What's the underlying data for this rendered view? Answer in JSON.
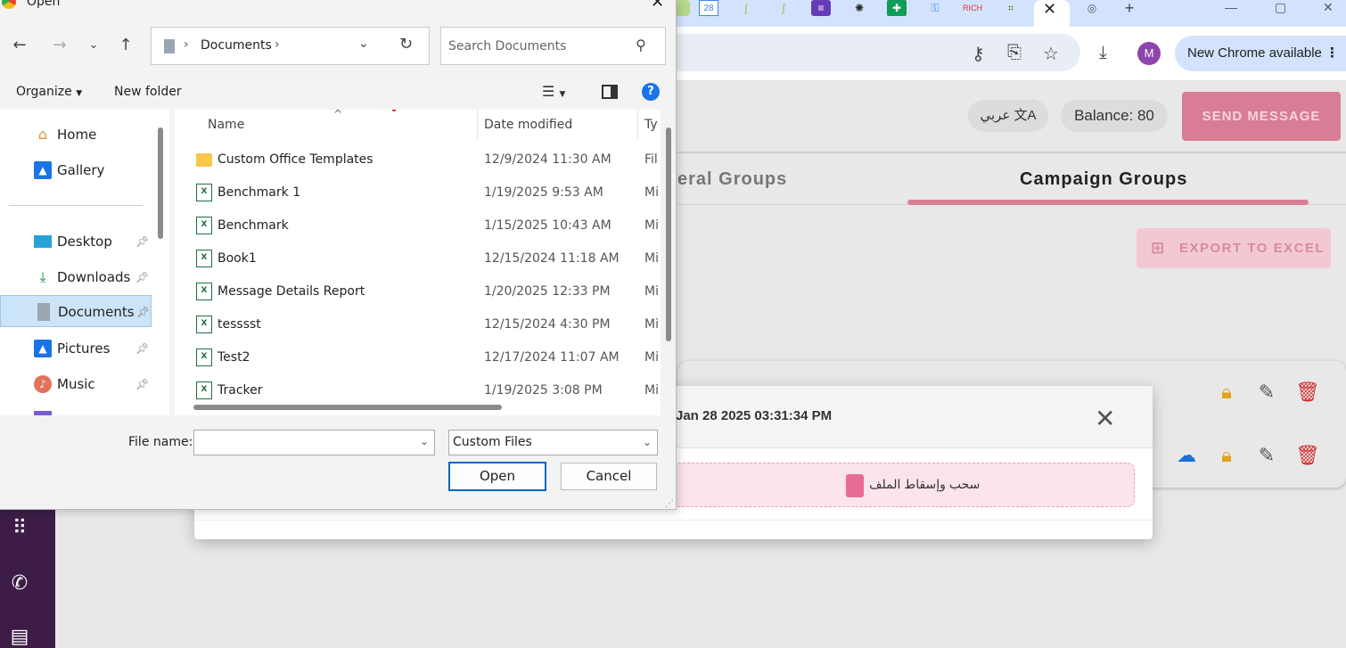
{
  "browser": {
    "calendar_tab_text": "28",
    "new_chrome_label": "New Chrome available",
    "avatar_letter": "M"
  },
  "page": {
    "language_label": "عربي",
    "balance_label": "Balance: 80",
    "send_button_label": "SEND MESSAGE",
    "tab_general_label": "eral Groups",
    "tab_campaign_label": "Campaign Groups",
    "export_button_label": "EXPORT TO EXCEL",
    "accent_color": "#d97c96"
  },
  "modal": {
    "title": "Jan 28 2025 03:31:34 PM",
    "dropzone_label": "سحب وإسقاط الملف"
  },
  "dialog": {
    "title": "Open",
    "address": {
      "current_folder": "Documents"
    },
    "search_placeholder": "Search Documents",
    "toolbar": {
      "organize_label": "Organize",
      "new_folder_label": "New folder"
    },
    "nav_items": [
      {
        "label": "Home",
        "icon": "home-icon",
        "pinned": false
      },
      {
        "label": "Gallery",
        "icon": "gallery-icon",
        "pinned": false
      },
      {
        "label": "Desktop",
        "icon": "desktop-icon",
        "pinned": true
      },
      {
        "label": "Downloads",
        "icon": "download-icon",
        "pinned": true
      },
      {
        "label": "Documents",
        "icon": "documents-icon",
        "pinned": true,
        "selected": true
      },
      {
        "label": "Pictures",
        "icon": "pictures-icon",
        "pinned": true
      },
      {
        "label": "Music",
        "icon": "music-icon",
        "pinned": true
      }
    ],
    "columns": {
      "name": "Name",
      "date_modified": "Date modified",
      "type": "Ty"
    },
    "files": [
      {
        "name": "Custom Office Templates",
        "date": "12/9/2024 11:30 AM",
        "type": "Fil",
        "icon": "folder-icon"
      },
      {
        "name": "Benchmark 1",
        "date": "1/19/2025 9:53 AM",
        "type": "Mi",
        "icon": "excel-icon"
      },
      {
        "name": "Benchmark",
        "date": "1/15/2025 10:43 AM",
        "type": "Mi",
        "icon": "excel-icon"
      },
      {
        "name": "Book1",
        "date": "12/15/2024 11:18 AM",
        "type": "Mi",
        "icon": "excel-icon"
      },
      {
        "name": "Message Details Report",
        "date": "1/20/2025 12:33 PM",
        "type": "Mi",
        "icon": "excel-icon"
      },
      {
        "name": "tesssst",
        "date": "12/15/2024 4:30 PM",
        "type": "Mi",
        "icon": "excel-icon"
      },
      {
        "name": "Test2",
        "date": "12/17/2024 11:07 AM",
        "type": "Mi",
        "icon": "excel-icon"
      },
      {
        "name": "Tracker",
        "date": "1/19/2025 3:08 PM",
        "type": "Mi",
        "icon": "excel-icon"
      }
    ],
    "file_name_label": "File name:",
    "file_name_value": "",
    "file_type_filter": "Custom Files",
    "open_button_label": "Open",
    "cancel_button_label": "Cancel"
  }
}
